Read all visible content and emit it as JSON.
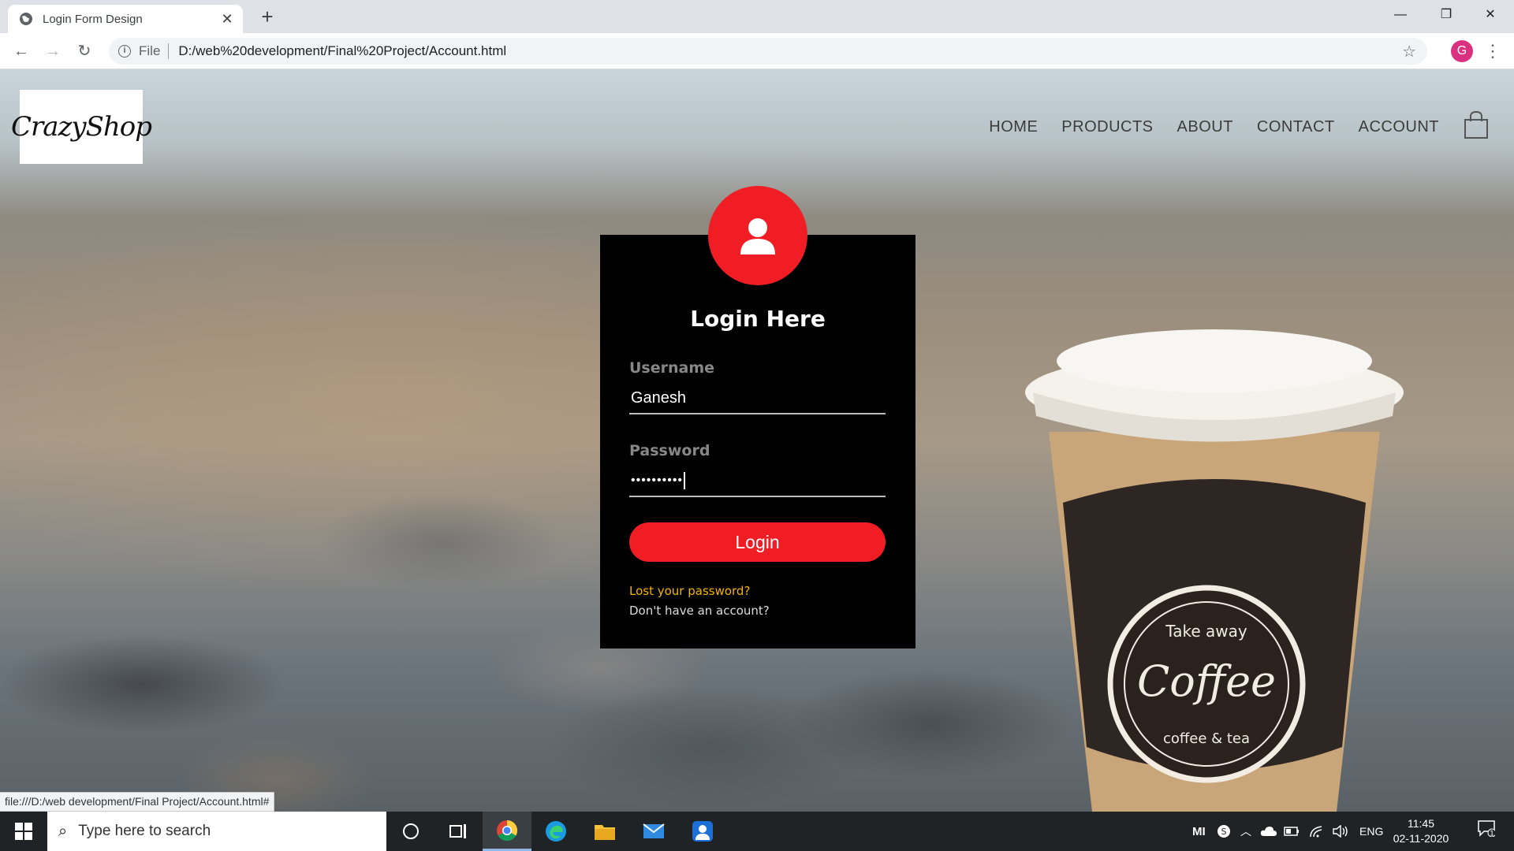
{
  "browser": {
    "tab_title": "Login Form Design",
    "tab_close": "✕",
    "new_tab": "+",
    "window_controls": {
      "minimize": "—",
      "restore": "❐",
      "close": "✕"
    },
    "nav": {
      "back": "←",
      "forward": "→",
      "reload": "↻"
    },
    "address": {
      "info": "i",
      "scheme_label": "File",
      "url": "D:/web%20development/Final%20Project/Account.html"
    },
    "bookmark": "☆",
    "profile_initial": "G",
    "menu": "⋮",
    "status_url": "file:///D:/web development/Final Project/Account.html#"
  },
  "site": {
    "logo_text": "CrazyShop",
    "nav": [
      "HOME",
      "PRODUCTS",
      "ABOUT",
      "CONTACT",
      "ACCOUNT"
    ],
    "cart_icon": "shopping-bag-icon"
  },
  "login": {
    "title": "Login Here",
    "username_label": "Username",
    "username_value": "Ganesh",
    "password_label": "Password",
    "password_value": "••••••••••",
    "button": "Login",
    "lost_password": "Lost your password?",
    "no_account": "Don't have an account?",
    "accent_color": "#f01e24"
  },
  "cup": {
    "line1": "Take away",
    "line2": "Coffee",
    "line3": "coffee & tea"
  },
  "taskbar": {
    "search_placeholder": "Type here to search",
    "tray_mi": "MI",
    "language": "ENG",
    "time": "11:45",
    "date": "02-11-2020",
    "notification_count": "1"
  }
}
